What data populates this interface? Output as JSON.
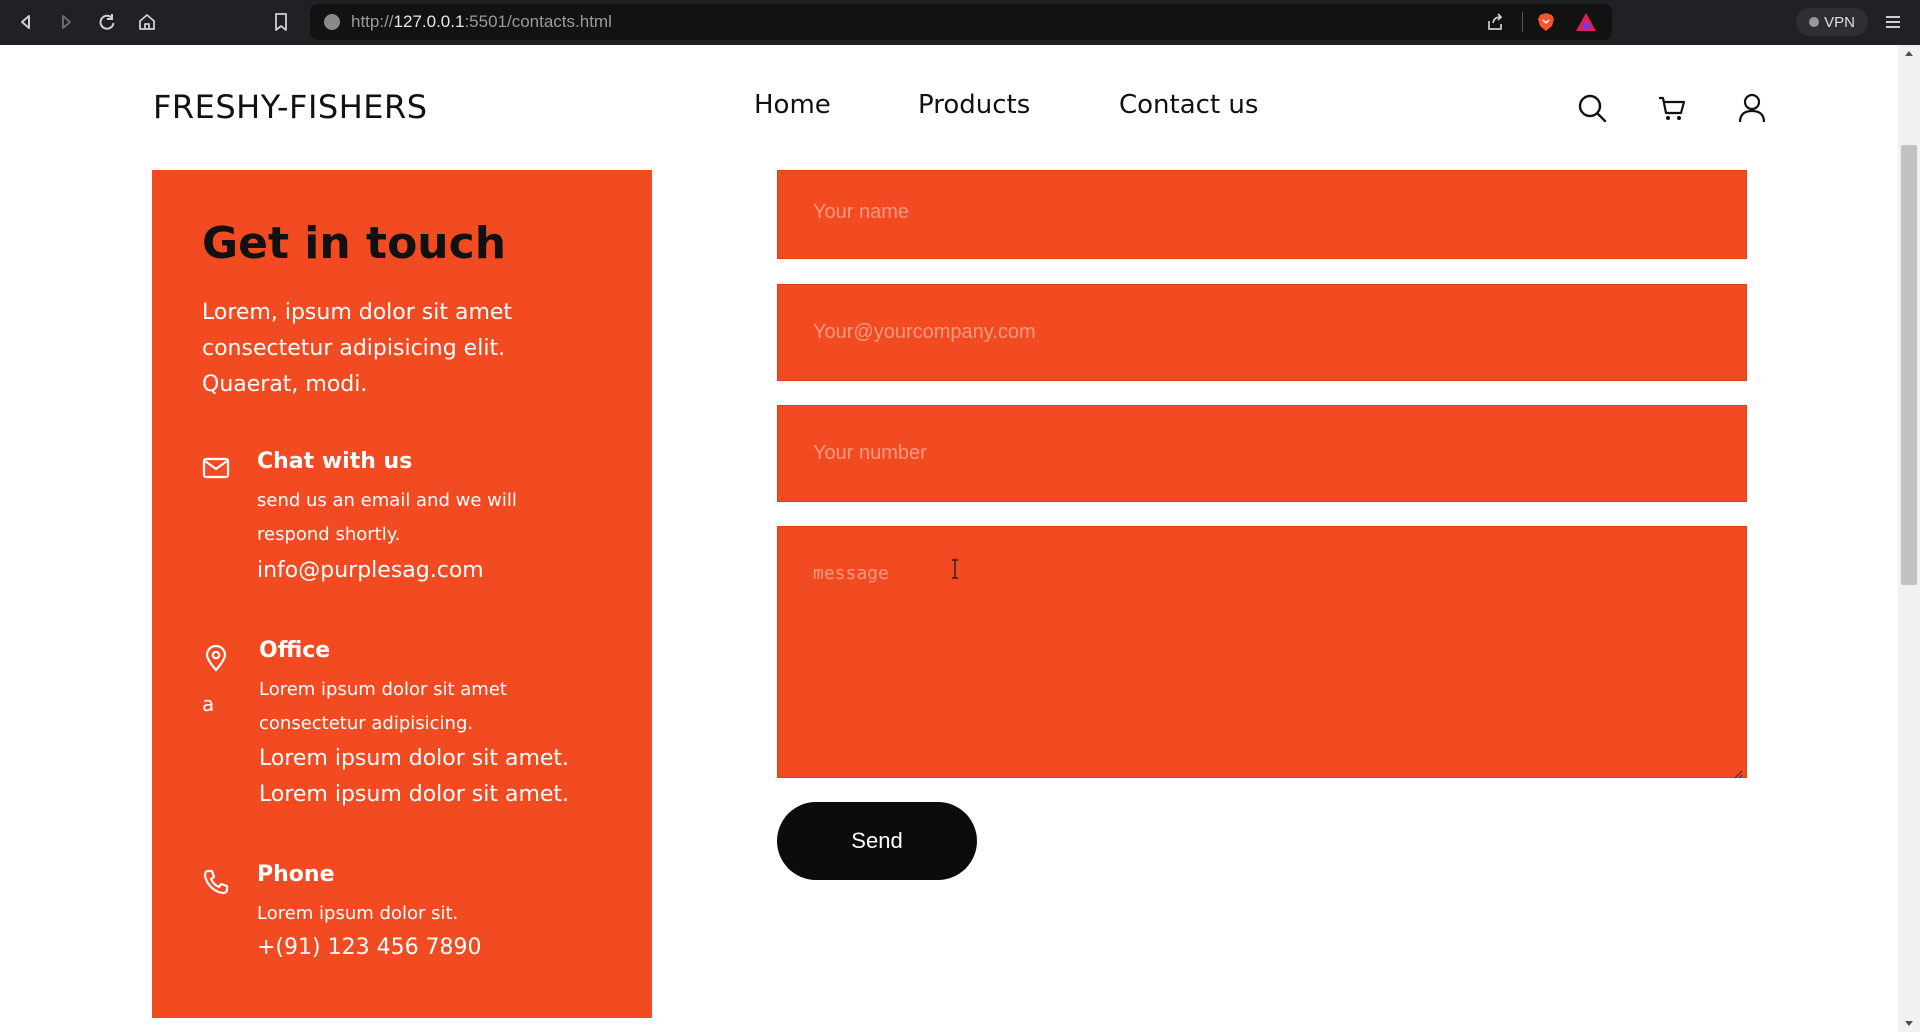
{
  "browser": {
    "url_prefix": "http://",
    "url_host": "127.0.0.1",
    "url_rest": ":5501/contacts.html",
    "vpn_label": "VPN"
  },
  "header": {
    "logo": "FRESHY-FISHERS",
    "nav": [
      "Home",
      "Products",
      "Contact us"
    ]
  },
  "info_card": {
    "title": "Get in touch",
    "description": "Lorem, ipsum dolor sit amet consectetur adipisicing elit. Quaerat, modi.",
    "chat": {
      "heading": "Chat with us",
      "text": "send us an email and we will respond shortly.",
      "email": "info@purplesag.com"
    },
    "office": {
      "heading": "Office",
      "stray": "a",
      "text": "Lorem ipsum dolor sit amet consectetur adipisicing.",
      "line1": "Lorem ipsum dolor sit amet.",
      "line2": "Lorem ipsum dolor sit amet."
    },
    "phone": {
      "heading": "Phone",
      "text": "Lorem ipsum dolor sit.",
      "number": "+(91) 123 456 7890"
    }
  },
  "form": {
    "name_placeholder": "Your name",
    "email_placeholder": "Your@yourcompany.com",
    "number_placeholder": "Your number",
    "message_placeholder": "message",
    "send_label": "Send"
  },
  "colors": {
    "accent": "#f24b22",
    "button": "#0c0c0c",
    "browser_bar": "#202124"
  }
}
